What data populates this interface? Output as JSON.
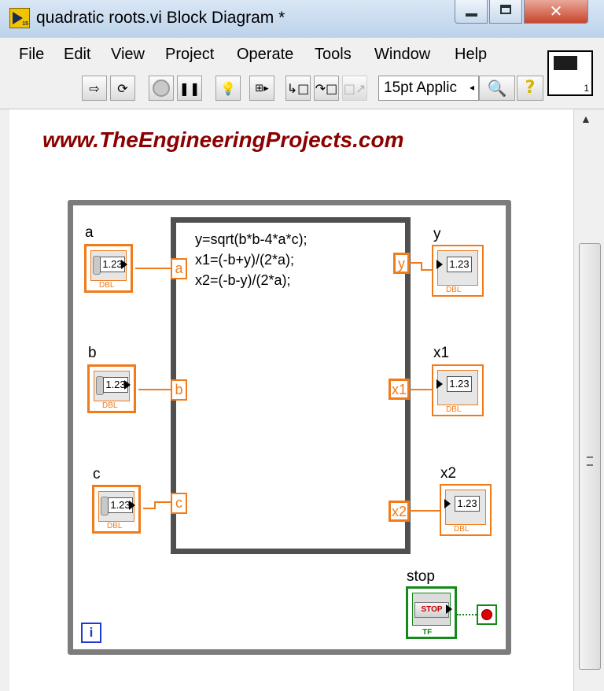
{
  "window": {
    "title": "quadratic roots.vi Block Diagram *",
    "icon_tag": "15"
  },
  "menu": [
    "File",
    "Edit",
    "View",
    "Project",
    "Operate",
    "Tools",
    "Window",
    "Help"
  ],
  "toolbar": {
    "font_value": "15pt Applic",
    "vi_icon_number": "1"
  },
  "diagram": {
    "watermark": "www.TheEngineeringProjects.com",
    "formula_lines": [
      "y=sqrt(b*b-4*a*c);",
      "x1=(-b+y)/(2*a);",
      "x2=(-b-y)/(2*a);"
    ],
    "inputs": [
      {
        "label": "a",
        "terminal": "a",
        "value": "1.23",
        "type": "DBL"
      },
      {
        "label": "b",
        "terminal": "b",
        "value": "1.23",
        "type": "DBL"
      },
      {
        "label": "c",
        "terminal": "c",
        "value": "1.23",
        "type": "DBL"
      }
    ],
    "outputs": [
      {
        "label": "y",
        "terminal": "y",
        "value": "1.23",
        "type": "DBL"
      },
      {
        "label": "x1",
        "terminal": "x1",
        "value": "1.23",
        "type": "DBL"
      },
      {
        "label": "x2",
        "terminal": "x2",
        "value": "1.23",
        "type": "DBL"
      }
    ],
    "stop": {
      "label": "stop",
      "button_text": "STOP",
      "type": "TF"
    },
    "iteration_label": "i"
  },
  "colors": {
    "numeric": "#f07b1a",
    "boolean": "#148a1a",
    "watermark": "#8b0000",
    "loop": "#7c7c7c"
  }
}
